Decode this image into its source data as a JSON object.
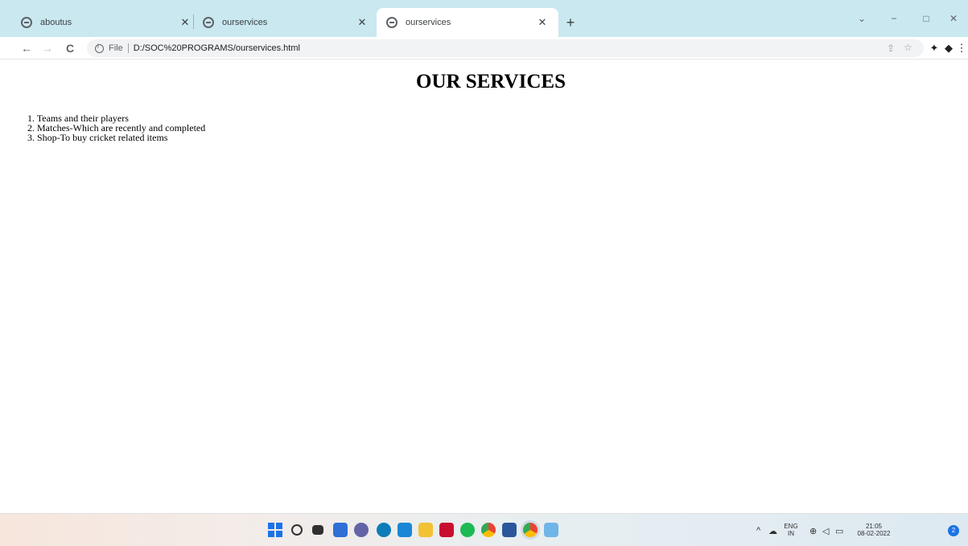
{
  "browser": {
    "tabs": [
      {
        "title": "aboutus",
        "active": false
      },
      {
        "title": "ourservices",
        "active": false
      },
      {
        "title": "ourservices",
        "active": true
      }
    ],
    "new_tab_label": "+",
    "window_controls": {
      "dropdown": "⌄",
      "minimize": "−",
      "maximize": "□",
      "close": "✕"
    },
    "nav": {
      "back": "←",
      "forward": "→",
      "reload": "C"
    },
    "address_bar": {
      "scheme": "File",
      "url": "D:/SOC%20PROGRAMS/ourservices.html"
    },
    "accent_color": "#c9e8f0"
  },
  "page": {
    "title": "OUR SERVICES",
    "services": [
      "1. Teams and their players",
      "2. Matches-Which are recently and completed",
      "3. Shop-To buy cricket related items"
    ]
  },
  "taskbar": {
    "language": {
      "line1": "ENG",
      "line2": "IN"
    },
    "clock": {
      "time": "21:05",
      "date": "08-02-2022"
    },
    "notification_count": "2"
  }
}
